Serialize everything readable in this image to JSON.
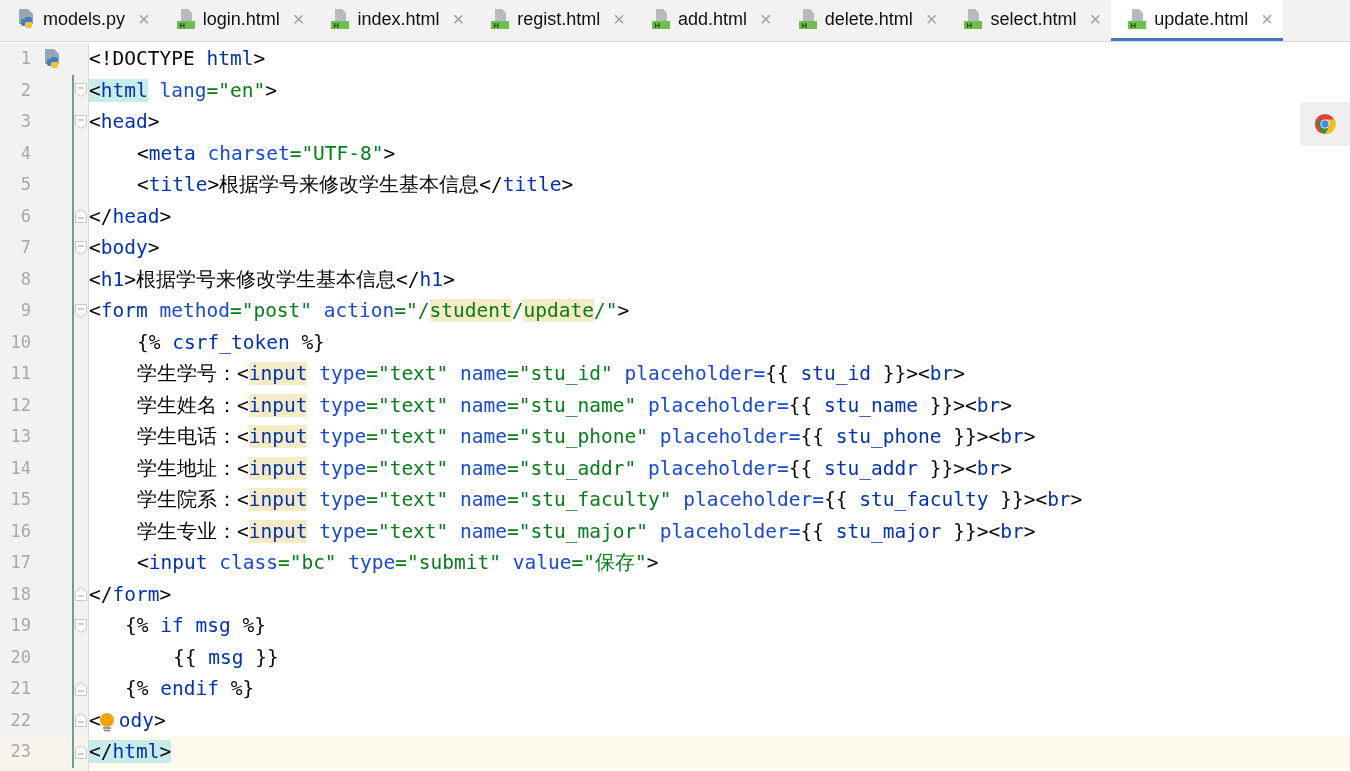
{
  "tabs": [
    {
      "label": "models.py",
      "kind": "python",
      "selected": false,
      "close": "×"
    },
    {
      "label": "login.html",
      "kind": "html",
      "selected": false,
      "close": "×"
    },
    {
      "label": "index.html",
      "kind": "html",
      "selected": false,
      "close": "×"
    },
    {
      "label": "regist.html",
      "kind": "html",
      "selected": false,
      "close": "×"
    },
    {
      "label": "add.html",
      "kind": "html",
      "selected": false,
      "close": "×"
    },
    {
      "label": "delete.html",
      "kind": "html",
      "selected": false,
      "close": "×"
    },
    {
      "label": "select.html",
      "kind": "html",
      "selected": false,
      "close": "×"
    },
    {
      "label": "update.html",
      "kind": "html",
      "selected": true,
      "close": "×"
    }
  ],
  "editor": {
    "lines": [
      {
        "number": "1",
        "kind": "flat",
        "file_icon": true,
        "fold_start": false,
        "fold_end": false,
        "bulb": false,
        "changed": false,
        "current": false,
        "tokens": [
          {
            "text": "<!DOCTYPE ",
            "kind": "punct"
          },
          {
            "text": "html",
            "kind": "tag"
          },
          {
            "text": ">",
            "kind": "punct"
          }
        ]
      },
      {
        "number": "2",
        "kind": "flat",
        "file_icon": false,
        "fold_start": true,
        "fold_end": false,
        "bulb": false,
        "changed": true,
        "current": false,
        "tokens": [
          {
            "text": "<",
            "kind": "punct",
            "matched": true
          },
          {
            "text": "html",
            "kind": "tag",
            "matched": true
          },
          {
            "text": " lang",
            "kind": "attr"
          },
          {
            "text": "=\"en\"",
            "kind": "string"
          },
          {
            "text": ">",
            "kind": "punct"
          }
        ]
      },
      {
        "number": "3",
        "kind": "flat",
        "file_icon": false,
        "fold_start": true,
        "fold_end": false,
        "bulb": false,
        "changed": true,
        "current": false,
        "tokens": [
          {
            "text": "<",
            "kind": "punct"
          },
          {
            "text": "head",
            "kind": "tag"
          },
          {
            "text": ">",
            "kind": "punct"
          }
        ]
      },
      {
        "number": "4",
        "kind": "block",
        "file_icon": false,
        "fold_start": false,
        "fold_end": false,
        "bulb": false,
        "changed": true,
        "current": false,
        "tokens": [
          {
            "text": "<",
            "kind": "punct"
          },
          {
            "text": "meta",
            "kind": "tag"
          },
          {
            "text": " charset",
            "kind": "attr"
          },
          {
            "text": "=\"UTF-8\"",
            "kind": "string"
          },
          {
            "text": ">",
            "kind": "punct"
          }
        ]
      },
      {
        "number": "5",
        "kind": "block",
        "file_icon": false,
        "fold_start": false,
        "fold_end": false,
        "bulb": false,
        "changed": true,
        "current": false,
        "tokens": [
          {
            "text": "<",
            "kind": "punct"
          },
          {
            "text": "title",
            "kind": "tag"
          },
          {
            "text": ">",
            "kind": "punct"
          },
          {
            "text": "根据学号来修改学生基本信息",
            "kind": "plain"
          },
          {
            "text": "</",
            "kind": "punct"
          },
          {
            "text": "title",
            "kind": "tag"
          },
          {
            "text": ">",
            "kind": "punct"
          }
        ]
      },
      {
        "number": "6",
        "kind": "flat",
        "file_icon": false,
        "fold_start": false,
        "fold_end": true,
        "bulb": false,
        "changed": true,
        "current": false,
        "tokens": [
          {
            "text": "</",
            "kind": "punct"
          },
          {
            "text": "head",
            "kind": "tag"
          },
          {
            "text": ">",
            "kind": "punct"
          }
        ]
      },
      {
        "number": "7",
        "kind": "flat",
        "file_icon": false,
        "fold_start": true,
        "fold_end": false,
        "bulb": false,
        "changed": true,
        "current": false,
        "tokens": [
          {
            "text": "<",
            "kind": "punct"
          },
          {
            "text": "body",
            "kind": "tag"
          },
          {
            "text": ">",
            "kind": "punct"
          }
        ]
      },
      {
        "number": "8",
        "kind": "flat",
        "file_icon": false,
        "fold_start": false,
        "fold_end": false,
        "bulb": false,
        "changed": true,
        "current": false,
        "tokens": [
          {
            "text": "<",
            "kind": "punct"
          },
          {
            "text": "h1",
            "kind": "tag"
          },
          {
            "text": ">",
            "kind": "punct"
          },
          {
            "text": "根据学号来修改学生基本信息",
            "kind": "plain"
          },
          {
            "text": "</",
            "kind": "punct"
          },
          {
            "text": "h1",
            "kind": "tag"
          },
          {
            "text": ">",
            "kind": "punct"
          }
        ]
      },
      {
        "number": "9",
        "kind": "flat",
        "file_icon": false,
        "fold_start": true,
        "fold_end": false,
        "bulb": false,
        "changed": true,
        "current": false,
        "tokens": [
          {
            "text": "<",
            "kind": "punct"
          },
          {
            "text": "form",
            "kind": "tag"
          },
          {
            "text": " method",
            "kind": "attr"
          },
          {
            "text": "=\"post\"",
            "kind": "string"
          },
          {
            "text": " action",
            "kind": "attr"
          },
          {
            "text": "=\"/",
            "kind": "string"
          },
          {
            "text": "student",
            "kind": "string",
            "usage": true
          },
          {
            "text": "/",
            "kind": "string"
          },
          {
            "text": "update",
            "kind": "string",
            "usage": true
          },
          {
            "text": "/\"",
            "kind": "string"
          },
          {
            "text": ">",
            "kind": "punct"
          }
        ]
      },
      {
        "number": "10",
        "kind": "block",
        "file_icon": false,
        "fold_start": false,
        "fold_end": false,
        "bulb": false,
        "changed": true,
        "current": false,
        "tokens": [
          {
            "text": "{%",
            "kind": "punct"
          },
          {
            "text": " csrf_token ",
            "kind": "keyword"
          },
          {
            "text": "%}",
            "kind": "punct"
          }
        ]
      },
      {
        "number": "11",
        "kind": "block",
        "file_icon": false,
        "fold_start": false,
        "fold_end": false,
        "bulb": false,
        "changed": true,
        "current": false,
        "tokens": [
          {
            "text": "学生学号：",
            "kind": "plain"
          },
          {
            "text": "<",
            "kind": "punct"
          },
          {
            "text": "input",
            "kind": "tag",
            "usage": true
          },
          {
            "text": " type",
            "kind": "attr"
          },
          {
            "text": "=\"text\"",
            "kind": "string"
          },
          {
            "text": " name",
            "kind": "attr"
          },
          {
            "text": "=\"stu_id\"",
            "kind": "string"
          },
          {
            "text": " placeholder=",
            "kind": "attr"
          },
          {
            "text": "{{ ",
            "kind": "punct"
          },
          {
            "text": "stu_id",
            "kind": "keyword"
          },
          {
            "text": " }}><",
            "kind": "punct"
          },
          {
            "text": "br",
            "kind": "tag"
          },
          {
            "text": ">",
            "kind": "punct"
          }
        ]
      },
      {
        "number": "12",
        "kind": "block",
        "file_icon": false,
        "fold_start": false,
        "fold_end": false,
        "bulb": false,
        "changed": true,
        "current": false,
        "tokens": [
          {
            "text": "学生姓名：",
            "kind": "plain"
          },
          {
            "text": "<",
            "kind": "punct"
          },
          {
            "text": "input",
            "kind": "tag",
            "usage": true
          },
          {
            "text": " type",
            "kind": "attr"
          },
          {
            "text": "=\"text\"",
            "kind": "string"
          },
          {
            "text": " name",
            "kind": "attr"
          },
          {
            "text": "=\"stu_name\"",
            "kind": "string"
          },
          {
            "text": " placeholder=",
            "kind": "attr"
          },
          {
            "text": "{{ ",
            "kind": "punct"
          },
          {
            "text": "stu_name",
            "kind": "keyword"
          },
          {
            "text": " }}><",
            "kind": "punct"
          },
          {
            "text": "br",
            "kind": "tag"
          },
          {
            "text": ">",
            "kind": "punct"
          }
        ]
      },
      {
        "number": "13",
        "kind": "block",
        "file_icon": false,
        "fold_start": false,
        "fold_end": false,
        "bulb": false,
        "changed": true,
        "current": false,
        "tokens": [
          {
            "text": "学生电话：",
            "kind": "plain"
          },
          {
            "text": "<",
            "kind": "punct"
          },
          {
            "text": "input",
            "kind": "tag",
            "usage": true
          },
          {
            "text": " type",
            "kind": "attr"
          },
          {
            "text": "=\"text\"",
            "kind": "string"
          },
          {
            "text": " name",
            "kind": "attr"
          },
          {
            "text": "=\"stu_phone\"",
            "kind": "string"
          },
          {
            "text": " placeholder=",
            "kind": "attr"
          },
          {
            "text": "{{ ",
            "kind": "punct"
          },
          {
            "text": "stu_phone",
            "kind": "keyword"
          },
          {
            "text": " }}><",
            "kind": "punct"
          },
          {
            "text": "br",
            "kind": "tag"
          },
          {
            "text": ">",
            "kind": "punct"
          }
        ]
      },
      {
        "number": "14",
        "kind": "block",
        "file_icon": false,
        "fold_start": false,
        "fold_end": false,
        "bulb": false,
        "changed": true,
        "current": false,
        "tokens": [
          {
            "text": "学生地址：",
            "kind": "plain"
          },
          {
            "text": "<",
            "kind": "punct"
          },
          {
            "text": "input",
            "kind": "tag",
            "usage": true
          },
          {
            "text": " type",
            "kind": "attr"
          },
          {
            "text": "=\"text\"",
            "kind": "string"
          },
          {
            "text": " name",
            "kind": "attr"
          },
          {
            "text": "=\"stu_addr\"",
            "kind": "string"
          },
          {
            "text": " placeholder=",
            "kind": "attr"
          },
          {
            "text": "{{ ",
            "kind": "punct"
          },
          {
            "text": "stu_addr",
            "kind": "keyword"
          },
          {
            "text": " }}><",
            "kind": "punct"
          },
          {
            "text": "br",
            "kind": "tag"
          },
          {
            "text": ">",
            "kind": "punct"
          }
        ]
      },
      {
        "number": "15",
        "kind": "block",
        "file_icon": false,
        "fold_start": false,
        "fold_end": false,
        "bulb": false,
        "changed": true,
        "current": false,
        "tokens": [
          {
            "text": "学生院系：",
            "kind": "plain"
          },
          {
            "text": "<",
            "kind": "punct"
          },
          {
            "text": "input",
            "kind": "tag",
            "usage": true
          },
          {
            "text": " type",
            "kind": "attr"
          },
          {
            "text": "=\"text\"",
            "kind": "string"
          },
          {
            "text": " name",
            "kind": "attr"
          },
          {
            "text": "=\"stu_faculty\"",
            "kind": "string"
          },
          {
            "text": " placeholder=",
            "kind": "attr"
          },
          {
            "text": "{{ ",
            "kind": "punct"
          },
          {
            "text": "stu_faculty",
            "kind": "keyword"
          },
          {
            "text": " }}><",
            "kind": "punct"
          },
          {
            "text": "br",
            "kind": "tag"
          },
          {
            "text": ">",
            "kind": "punct"
          }
        ]
      },
      {
        "number": "16",
        "kind": "block",
        "file_icon": false,
        "fold_start": false,
        "fold_end": false,
        "bulb": false,
        "changed": true,
        "current": false,
        "tokens": [
          {
            "text": "学生专业：",
            "kind": "plain"
          },
          {
            "text": "<",
            "kind": "punct"
          },
          {
            "text": "input",
            "kind": "tag",
            "usage": true
          },
          {
            "text": " type",
            "kind": "attr"
          },
          {
            "text": "=\"text\"",
            "kind": "string"
          },
          {
            "text": " name",
            "kind": "attr"
          },
          {
            "text": "=\"stu_major\"",
            "kind": "string"
          },
          {
            "text": " placeholder=",
            "kind": "attr"
          },
          {
            "text": "{{ ",
            "kind": "punct"
          },
          {
            "text": "stu_major",
            "kind": "keyword"
          },
          {
            "text": " }}><",
            "kind": "punct"
          },
          {
            "text": "br",
            "kind": "tag"
          },
          {
            "text": ">",
            "kind": "punct"
          }
        ]
      },
      {
        "number": "17",
        "kind": "block",
        "file_icon": false,
        "fold_start": false,
        "fold_end": false,
        "bulb": false,
        "changed": true,
        "current": false,
        "tokens": [
          {
            "text": "<",
            "kind": "punct"
          },
          {
            "text": "input",
            "kind": "tag"
          },
          {
            "text": " class",
            "kind": "attr"
          },
          {
            "text": "=\"bc\"",
            "kind": "string"
          },
          {
            "text": " type",
            "kind": "attr"
          },
          {
            "text": "=\"submit\"",
            "kind": "string"
          },
          {
            "text": " value",
            "kind": "attr"
          },
          {
            "text": "=\"保存\"",
            "kind": "string"
          },
          {
            "text": ">",
            "kind": "punct"
          }
        ]
      },
      {
        "number": "18",
        "kind": "flat",
        "file_icon": false,
        "fold_start": false,
        "fold_end": true,
        "bulb": false,
        "changed": true,
        "current": false,
        "tokens": [
          {
            "text": "</",
            "kind": "punct"
          },
          {
            "text": "form",
            "kind": "tag"
          },
          {
            "text": ">",
            "kind": "punct"
          }
        ]
      },
      {
        "number": "19",
        "kind": "template",
        "file_icon": false,
        "fold_start": true,
        "fold_end": false,
        "bulb": false,
        "changed": true,
        "current": false,
        "tokens": [
          {
            "text": "{%",
            "kind": "punct"
          },
          {
            "text": " if msg ",
            "kind": "keyword"
          },
          {
            "text": "%}",
            "kind": "punct"
          }
        ]
      },
      {
        "number": "20",
        "kind": "nested",
        "file_icon": false,
        "fold_start": false,
        "fold_end": false,
        "bulb": false,
        "changed": true,
        "current": false,
        "tokens": [
          {
            "text": "{{ ",
            "kind": "punct"
          },
          {
            "text": "msg",
            "kind": "keyword"
          },
          {
            "text": " }}",
            "kind": "punct"
          }
        ]
      },
      {
        "number": "21",
        "kind": "template",
        "file_icon": false,
        "fold_start": false,
        "fold_end": true,
        "bulb": false,
        "changed": true,
        "current": false,
        "tokens": [
          {
            "text": "{%",
            "kind": "punct"
          },
          {
            "text": " endif ",
            "kind": "keyword"
          },
          {
            "text": "%}",
            "kind": "punct"
          }
        ]
      },
      {
        "number": "22",
        "kind": "flat",
        "file_icon": false,
        "fold_start": false,
        "fold_end": true,
        "bulb": true,
        "changed": true,
        "current": false,
        "tokens": [
          {
            "text": "<",
            "kind": "punct"
          },
          {
            "kind": "bulb"
          },
          {
            "text": "ody",
            "kind": "tag"
          },
          {
            "text": ">",
            "kind": "punct"
          }
        ]
      },
      {
        "number": "23",
        "kind": "flat",
        "file_icon": false,
        "fold_start": false,
        "fold_end": true,
        "bulb": false,
        "changed": true,
        "current": true,
        "tokens": [
          {
            "text": "</",
            "kind": "punct",
            "matched": true
          },
          {
            "text": "html",
            "kind": "tag",
            "matched": true
          },
          {
            "text": ">",
            "kind": "punct",
            "matched": true
          }
        ]
      }
    ]
  }
}
